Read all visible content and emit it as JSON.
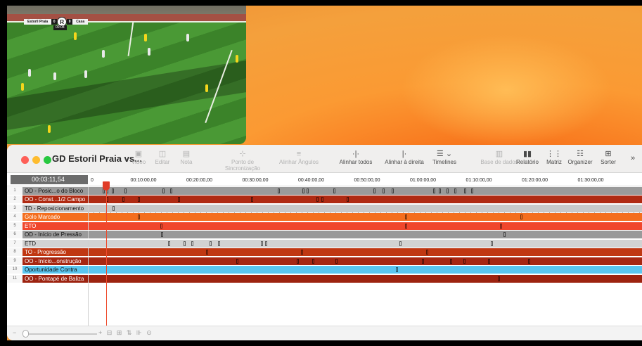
{
  "video": {
    "home_team": "Estoril Praia",
    "home_score": "0",
    "away_team": "Casa",
    "away_score": "0",
    "crest": "R",
    "clock": "00:08"
  },
  "window": {
    "title": "GD Estoril Praia vs...",
    "title_chevron": "⌄",
    "toolbar": [
      {
        "id": "video",
        "label": "Video",
        "icon": "▣",
        "enabled": false
      },
      {
        "id": "editar",
        "label": "Editar",
        "icon": "◫",
        "enabled": false
      },
      {
        "id": "nota",
        "label": "Nota",
        "icon": "▤",
        "enabled": false
      },
      {
        "id": "sync",
        "label": "Ponto de Sincronização",
        "icon": "⊹",
        "enabled": false
      },
      {
        "id": "align-angles",
        "label": "Alinhar Ângulos",
        "icon": "≡",
        "enabled": false
      },
      {
        "id": "align-all",
        "label": "Alinhar todos",
        "icon": "·|·",
        "enabled": true
      },
      {
        "id": "align-right",
        "label": "Alinhar à direita",
        "icon": "|·",
        "enabled": true
      },
      {
        "id": "timelines",
        "label": "Timelines",
        "icon": "☰ ⌄",
        "enabled": true
      },
      {
        "id": "database",
        "label": "Base de dados",
        "icon": "▥",
        "enabled": false
      },
      {
        "id": "report",
        "label": "Relatório",
        "icon": "▮▮",
        "enabled": true
      },
      {
        "id": "matrix",
        "label": "Matriz",
        "icon": "⋮⋮",
        "enabled": true
      },
      {
        "id": "organizer",
        "label": "Organizer",
        "icon": "☷",
        "enabled": true
      },
      {
        "id": "sorter",
        "label": "Sorter",
        "icon": "⊞",
        "enabled": true
      },
      {
        "id": "more",
        "label": "",
        "icon": "»",
        "enabled": true
      }
    ]
  },
  "timeline": {
    "current_time": "00:03:11,54",
    "ruler_labels": [
      "0",
      "00:10:00,00",
      "00:20:00,00",
      "00:30:00,00",
      "00:40:00,00",
      "00:50:00,00",
      "01:00:00,00",
      "01:10:00,00",
      "01:20:00,00",
      "01:30:00,00"
    ],
    "playhead_minutes": 3.2,
    "rows": [
      {
        "num": "1",
        "label": "OD - Posic...o do Bloco",
        "color": "#9a9a9a",
        "marks": [
          2.5,
          3.1,
          4.2,
          6.4,
          13.2,
          14.6,
          33.8,
          38.2,
          39.0,
          43.8,
          51.0,
          52.6,
          54.2,
          61.6,
          62.6,
          64.0,
          65.4,
          67.2,
          68.4
        ]
      },
      {
        "num": "2",
        "label": "OO - Const...1/2 Campo",
        "color": "#b02a12",
        "marks": [
          3.2,
          6.0,
          8.8,
          16.0,
          29.0,
          40.8,
          41.6,
          46.2
        ]
      },
      {
        "num": "3",
        "label": "TD - Reposicionamento",
        "color": "#c8c8c8",
        "marks": [
          4.3
        ]
      },
      {
        "num": "4",
        "label": "Golo Marcado",
        "color": "#f46e1e",
        "marks": [
          8.8,
          56.6,
          77.2
        ]
      },
      {
        "num": "5",
        "label": "ETO",
        "color": "#f0472c",
        "marks": [
          12.8,
          56.6,
          73.6
        ]
      },
      {
        "num": "6",
        "label": "OD - Início de Pressão",
        "color": "#9a9a9a",
        "marks": [
          13.0,
          74.2
        ]
      },
      {
        "num": "7",
        "label": "ETD",
        "color": "#d2d2d2",
        "marks": [
          14.2,
          17.0,
          18.4,
          21.6,
          23.2,
          30.8,
          31.6,
          55.6,
          72.0
        ]
      },
      {
        "num": "8",
        "label": "TO - Progressão",
        "color": "#c03712",
        "marks": [
          21.0,
          38.0,
          60.4
        ]
      },
      {
        "num": "9",
        "label": "OO - Início...onstrução",
        "color": "#a72712",
        "marks": [
          26.4,
          37.2,
          40.0,
          44.2,
          59.6,
          64.6,
          67.0,
          71.4,
          78.6
        ]
      },
      {
        "num": "10",
        "label": "Oportunidade Contra",
        "color": "#5ac6f0",
        "marks": [
          55.0
        ]
      },
      {
        "num": "11",
        "label": "OO - Pontapé de Baliza",
        "color": "#9d2310",
        "marks": [
          73.2
        ]
      }
    ]
  },
  "bottom_bar": {
    "minus": "−",
    "tools": "+ ⊟ ⊞ ⇅ ⊪ ⊙"
  }
}
